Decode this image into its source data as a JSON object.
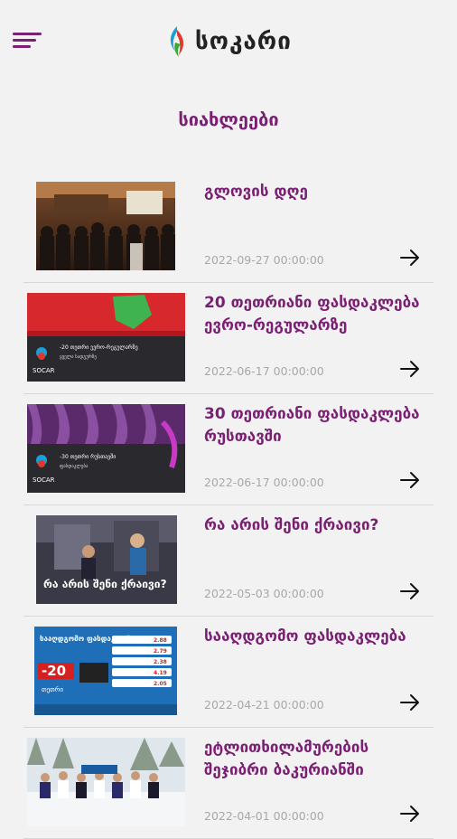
{
  "header": {
    "brand": "სოკარი"
  },
  "page": {
    "title": "სიახლეები"
  },
  "news": [
    {
      "title": "გლოვის დღე",
      "date": "2022-09-27 00:00:00",
      "thumb": "conference-hall-photo"
    },
    {
      "title": "20 თეთრიანი ფასდაკლება ევრო-რეგულარზე",
      "date": "2022-06-17 00:00:00",
      "thumb": "socar-promo-red-car"
    },
    {
      "title": "30 თეთრიანი ფასდაკლება რუსთავში",
      "date": "2022-06-17 00:00:00",
      "thumb": "socar-promo-purple"
    },
    {
      "title": "რა არის შენი ქრაივი?",
      "date": "2022-05-03 00:00:00",
      "thumb": "drive-photo"
    },
    {
      "title": "სააღდგომო ფასდაკლება",
      "date": "2022-04-21 00:00:00",
      "thumb": "easter-discount-banner"
    },
    {
      "title": "ეტლითხილამურების შეჯიბრი ბაკურიანში",
      "date": "2022-04-01 00:00:00",
      "thumb": "snow-group-photo"
    }
  ],
  "banners": {
    "promo1": {
      "line1": "-20 თეთრი ევრო-რეგულარზე",
      "line2": "ყველა სადგურზე",
      "brand": "SOCAR"
    },
    "promo2": {
      "line1": "-30 თეთრი რუსთავში",
      "line2": "ფასდაკლება",
      "brand": "SOCAR"
    },
    "drive": {
      "caption": "რა არის შენი ქრაივი?"
    },
    "easter": {
      "heading": "სააღდგომო ფასდაკლება",
      "big": "-20",
      "unit": "თეთრი",
      "prices": [
        "2.88",
        "2.79",
        "2.38",
        "4.19",
        "2.05"
      ]
    }
  },
  "colors": {
    "accent": "#7a1f73",
    "date": "#a8a8a8",
    "background": "#f2f2f2"
  }
}
